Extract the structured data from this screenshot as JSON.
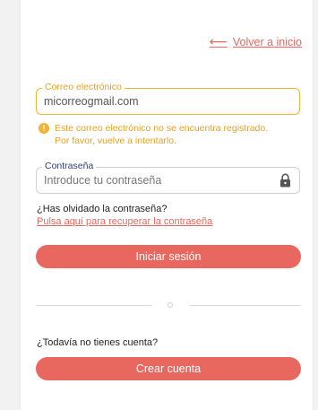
{
  "header": {
    "back_label": "Volver a inicio"
  },
  "email": {
    "legend": "Correo electrónico",
    "value": "micorreogmail.com",
    "error_line1": "Este correo electrónico no se encuentra registrado.",
    "error_line2": "Por favor, vuelve a intentarlo."
  },
  "password": {
    "legend": "Contraseña",
    "placeholder": "Introduce tu contraseña"
  },
  "forgot": {
    "question": "¿Has olvidado la contraseña?",
    "link": "Pulsa aquí para recuperar la contraseña"
  },
  "login_button": "Iniciar sesión",
  "signup": {
    "question": "¿Todavía no tienes cuenta?",
    "button": "Crear cuenta"
  },
  "icons": {
    "back": "arrow-left-icon",
    "warning": "warning-icon",
    "lock": "lock-icon"
  },
  "colors": {
    "accent": "#e8675e",
    "warning": "#f2b233",
    "legend_blue": "#2c3e7a"
  }
}
